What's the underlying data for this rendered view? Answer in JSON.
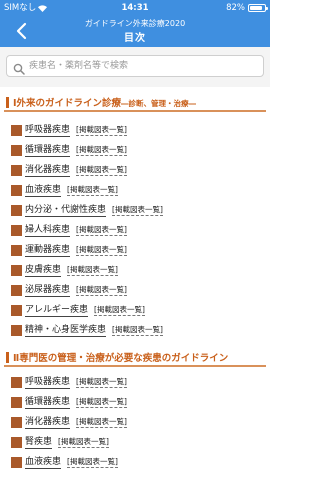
{
  "status_bar": {
    "carrier": "SIMなし",
    "time": "14:31",
    "battery": "82%"
  },
  "header": {
    "app_title": "ガイドライン外来診療2020",
    "page_title": "目次"
  },
  "search": {
    "placeholder": "疾患名・薬剤名等で検索"
  },
  "sections": [
    {
      "title_main": "Ⅰ外来のガイドライン診療",
      "title_sub": "―診断、管理・治療―",
      "items": [
        {
          "label": "呼吸器疾患",
          "link": "[掲載図表一覧]"
        },
        {
          "label": "循環器疾患",
          "link": "[掲載図表一覧]"
        },
        {
          "label": "消化器疾患",
          "link": "[掲載図表一覧]"
        },
        {
          "label": "血液疾患",
          "link": "[掲載図表一覧]"
        },
        {
          "label": "内分泌・代謝性疾患",
          "link": "[掲載図表一覧]"
        },
        {
          "label": "婦人科疾患",
          "link": "[掲載図表一覧]"
        },
        {
          "label": "運動器疾患",
          "link": "[掲載図表一覧]"
        },
        {
          "label": "皮膚疾患",
          "link": "[掲載図表一覧]"
        },
        {
          "label": "泌尿器疾患",
          "link": "[掲載図表一覧]"
        },
        {
          "label": "アレルギー疾患",
          "link": "[掲載図表一覧]"
        },
        {
          "label": "精神・心身医学疾患",
          "link": "[掲載図表一覧]"
        }
      ]
    },
    {
      "title_main": "Ⅱ専門医の管理・治療が必要な疾患のガイドライン",
      "title_sub": "",
      "items": [
        {
          "label": "呼吸器疾患",
          "link": "[掲載図表一覧]"
        },
        {
          "label": "循環器疾患",
          "link": "[掲載図表一覧]"
        },
        {
          "label": "消化器疾患",
          "link": "[掲載図表一覧]"
        },
        {
          "label": "腎疾患",
          "link": "[掲載図表一覧]"
        },
        {
          "label": "血液疾患",
          "link": "[掲載図表一覧]"
        }
      ]
    }
  ],
  "colors": {
    "nav_bg": "#3f8fe0",
    "accent": "#c9601b",
    "bullet": "#a9592a"
  }
}
